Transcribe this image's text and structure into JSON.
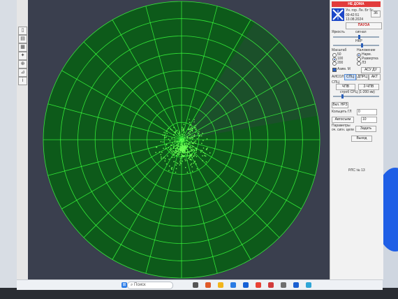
{
  "colors": {
    "radar_bg": "#3a3f4e",
    "radar_grid": "#39ff3c",
    "radar_fill": "#0d5a1a",
    "sector": "#1f4f2e",
    "targets": "#6dff55",
    "status_red": "#e23b3b",
    "panel_bg": "#f2f2f2",
    "accent_blue": "#2a62c9"
  },
  "panel": {
    "status_banner": "НЕ ДОМА",
    "station_id": "Ун. гор. Лн. Бт 5с",
    "time": "09:42:51",
    "date": "13.08.2024",
    "counter": "36",
    "pause_button": "ПАУЗА",
    "brightness_label": "Яркость",
    "brightness_value": "сигнал",
    "range_label": "НКР",
    "scale_label": "Масштаб",
    "scale_options": [
      "50",
      "100",
      "200"
    ],
    "display_label": "Наложение",
    "display_options": [
      "Нарм.",
      "Развертка",
      "ЛЗ"
    ],
    "checkbox_label": "Азим. М",
    "checkbox2_label": "АСУ ДУ",
    "mode_label": "АИСОЛ",
    "mode_buttons": [
      "СПЦ",
      "ДПРЦ",
      "АКТ"
    ],
    "sps_label": "СПЦ",
    "chp_buttons": [
      "ЧПВ",
      "2-ЧПВ"
    ],
    "range_scale_text": "строб СРЦ (1-200 км)",
    "mode_button": "Вкл. НРЗ",
    "count_label": "Кольцеть ГЛ",
    "count_value": "0",
    "auto_label": "Автосъем",
    "auto_value": "10",
    "params_label": "Параметры оч. сигн. цели",
    "params_button": "Задать",
    "apply_button": "Выход",
    "footer_label": "РЛС № 13"
  },
  "taskbar": {
    "search_placeholder": "Поиск",
    "start_icon": "windows-start-icon",
    "tray_icons": [
      "task-view-icon",
      "edge-icon",
      "file-explorer-icon",
      "store-icon",
      "mail-icon",
      "chrome-icon",
      "app-icon",
      "settings-icon",
      "security-icon",
      "app2-icon"
    ]
  },
  "toolbar": {
    "icons": [
      "document-icon",
      "save-icon",
      "print-icon",
      "settings-icon",
      "zoom-icon",
      "measure-icon",
      "info-icon",
      "tool-icon",
      "flag-icon",
      "scissors-icon"
    ]
  }
}
